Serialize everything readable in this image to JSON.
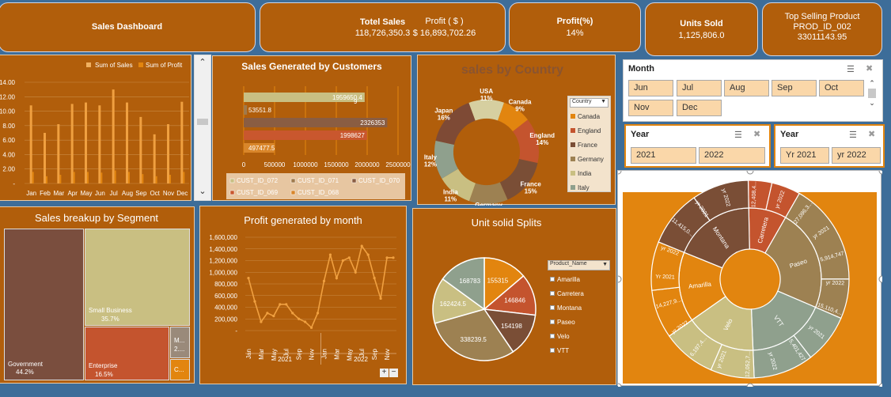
{
  "header": {
    "title": "Sales Dashboard",
    "kpis": [
      {
        "label": "Totel Sales",
        "value": "118,726,350.3"
      },
      {
        "label": "Profit ( $ )",
        "value": "$ 16,893,702.26"
      },
      {
        "label": "Profit(%)",
        "value": "14%"
      },
      {
        "label": "Units Sold",
        "value": "1,125,806.0"
      },
      {
        "label": "Top Selling Product",
        "value": "PROD_ID_002",
        "extra": "33011143.95"
      }
    ]
  },
  "monthly": {
    "legend": [
      "Sum of Sales",
      "Sum of Profit"
    ],
    "yticks": [
      "14.00",
      "12.00",
      "10.00",
      "8.00",
      "6.00",
      "4.00",
      "2.00",
      "-"
    ],
    "months": [
      "Jan",
      "Feb",
      "Mar",
      "Apr",
      "May",
      "Jun",
      "Jul",
      "Aug",
      "Sep",
      "Oct",
      "Nov",
      "Dec"
    ],
    "sales": [
      10.8,
      7.0,
      8.2,
      11.0,
      11.2,
      10.8,
      13.0,
      11.2,
      9.2,
      6.8,
      8.2,
      11.3
    ],
    "profit": [
      1.6,
      1.0,
      1.2,
      1.6,
      1.6,
      1.5,
      1.8,
      1.6,
      1.3,
      1.0,
      1.2,
      1.6
    ]
  },
  "customers": {
    "title": "Sales Generated by Customers",
    "xticks": [
      "0",
      "500000",
      "1000000",
      "1500000",
      "2000000",
      "2500000"
    ],
    "bars": [
      {
        "value": 1959650.49,
        "label": "1959650.4",
        "label2": "9",
        "color": "#c9bf82"
      },
      {
        "value": 53551.8,
        "label": "53551.8",
        "color": "#a07a4c"
      },
      {
        "value": 2326353,
        "label": "2326353",
        "color": "#8a5d42"
      },
      {
        "value": 1998627,
        "label": "1998627",
        "color": "#c9572e"
      },
      {
        "value": 497477.5,
        "label": "497477.5",
        "color": "#d9862a"
      }
    ],
    "legend": [
      {
        "name": "CUST_ID_072",
        "color": "#c9bf82"
      },
      {
        "name": "CUST_ID_071",
        "color": "#a07a4c"
      },
      {
        "name": "CUST_ID_070",
        "color": "#8a5d42"
      },
      {
        "name": "CUST_ID_069",
        "color": "#c9572e"
      },
      {
        "name": "CUST_ID_068",
        "color": "#d9862a"
      }
    ]
  },
  "country": {
    "title": "sales by Country",
    "filter_label": "Country",
    "slices": [
      {
        "name": "USA",
        "pct": 11,
        "label": "11%",
        "color": "#d6cfa0"
      },
      {
        "name": "Canada",
        "pct": 9,
        "label": "9%",
        "color": "#e2850f"
      },
      {
        "name": "England",
        "pct": 14,
        "label": "14%",
        "color": "#c4542e"
      },
      {
        "name": "France",
        "pct": 15,
        "label": "15%",
        "color": "#7a4e36"
      },
      {
        "name": "Germany",
        "pct": 12,
        "label": "12%",
        "color": "#9d8152"
      },
      {
        "name": "India",
        "pct": 11,
        "label": "11%",
        "color": "#c9bf82"
      },
      {
        "name": "Italy",
        "pct": 12,
        "label": "12%",
        "color": "#8fa08d"
      },
      {
        "name": "Japan",
        "pct": 16,
        "label": "16%",
        "color": "#7e4a35"
      }
    ],
    "legend": [
      "Canada",
      "England",
      "France",
      "Germany",
      "India",
      "Italy"
    ]
  },
  "slicers": {
    "month": {
      "title": "Month",
      "items": [
        "Jun",
        "Jul",
        "Aug",
        "Sep",
        "Oct",
        "Nov",
        "Dec"
      ]
    },
    "year": {
      "title": "Year",
      "items": [
        "2021",
        "2022"
      ]
    },
    "year2": {
      "title": "Year",
      "items": [
        "Yr 2021",
        "yr 2022"
      ]
    }
  },
  "segment": {
    "title": "Sales breakup by Segment",
    "items": [
      {
        "name": "Government",
        "pct": "44.2%",
        "color": "#7a4e3e"
      },
      {
        "name": "Small Business",
        "pct": "35.7%",
        "color": "#c9bf82"
      },
      {
        "name": "Enterprise",
        "pct": "16.5%",
        "color": "#c4542e"
      },
      {
        "name": "M...",
        "pct": "2....",
        "color": "#9a8a7a"
      },
      {
        "name": "C...",
        "pct": "",
        "color": "#e2850f"
      }
    ]
  },
  "profit_month": {
    "title": "Profit generated  by month",
    "yticks": [
      "1,600,000",
      "1,400,000",
      "1,200,000",
      "1,000,000",
      "800,000",
      "600,000",
      "400,000",
      "200,000",
      "-"
    ],
    "month_labels": [
      "Jan",
      "Mar",
      "May",
      "Jul",
      "Sep",
      "Nov",
      "Jan",
      "Mar",
      "May",
      "Jul",
      "Sep",
      "Nov"
    ],
    "years": [
      "2021",
      "2022"
    ],
    "values": [
      900000,
      500000,
      150000,
      300000,
      250000,
      450000,
      450000,
      300000,
      200000,
      150000,
      50000,
      300000,
      850000,
      1300000,
      900000,
      1200000,
      1250000,
      1000000,
      1450000,
      1300000,
      900000,
      550000,
      1250000,
      1250000
    ]
  },
  "units": {
    "title": "Unit solid Splits",
    "filter_label": "Product_Name",
    "slices": [
      {
        "name": "Amarilla",
        "value": 155315,
        "label": "155315",
        "color": "#e2850f"
      },
      {
        "name": "Carretera",
        "value": 146846,
        "label": "146846",
        "color": "#c4542e"
      },
      {
        "name": "Montana",
        "value": 154198,
        "label": "154198",
        "color": "#7a4e36"
      },
      {
        "name": "Paseo",
        "value": 338239.5,
        "label": "338239.5",
        "color": "#9d8152"
      },
      {
        "name": "Velo",
        "value": 162424.5,
        "label": "162424.5",
        "color": "#c9bf82"
      },
      {
        "name": "VTT",
        "value": 168783,
        "label": "168783",
        "color": "#8fa08d"
      }
    ],
    "legend": [
      "Amarilla",
      "Carretera",
      "Montana",
      "Paseo",
      "Velo",
      "VTT"
    ]
  },
  "sunburst": {
    "inner": [
      {
        "name": "Carretera",
        "color": "#c4542e"
      },
      {
        "name": "Paseo",
        "color": "#9d8152"
      },
      {
        "name": "VTT",
        "color": "#8fa08d"
      },
      {
        "name": "Velo",
        "color": "#c9bf82"
      },
      {
        "name": "Amarilla",
        "color": "#e2850f"
      },
      {
        "name": "Montana",
        "color": "#7a4e36"
      }
    ],
    "outer_labels": [
      "yr 2022",
      "27,096,3...",
      "yr 2021",
      "5,914,747",
      "yr 2022",
      "15,110,4...",
      "yr 2021",
      "5,401,427",
      "yr 2022",
      "12,052,7...",
      "yr 2021",
      "6,197,4...",
      "yr 2022",
      "14,227,9...",
      "Yr 2021",
      "yr 2022",
      "11,415,0...",
      "yr 2021",
      "yr 2022",
      "12,408,4..."
    ]
  }
}
